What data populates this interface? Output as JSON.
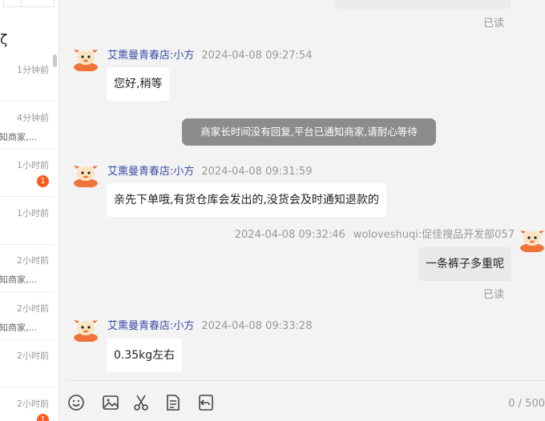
{
  "sidebar": {
    "title_fragment": "ζ",
    "items": [
      {
        "time": "1分钟前",
        "preview": "",
        "badge": ""
      },
      {
        "time": "4分钟前",
        "preview": "知商家,...",
        "badge": ""
      },
      {
        "time": "1小时前",
        "preview": "",
        "badge": "1"
      },
      {
        "time": "1小时前",
        "preview": "",
        "badge": ""
      },
      {
        "time": "2小时前",
        "preview": "知商家,...",
        "badge": ""
      },
      {
        "time": "2小时前",
        "preview": "知商家,...",
        "badge": ""
      },
      {
        "time": "2小时前",
        "preview": "",
        "badge": ""
      },
      {
        "time": "2小时前",
        "preview": "",
        "badge": "1"
      }
    ]
  },
  "chat": {
    "read_status": "已读",
    "messages": [
      {
        "sender": "艾熏曼青春店:小方",
        "time": "2024-04-08 09:27:54",
        "text": "您好,稍等"
      },
      {
        "sender": "艾熏曼青春店:小方",
        "time": "2024-04-08 09:31:59",
        "text": "亲先下单哦,有货仓库会发出的,没货会及时通知退款的"
      },
      {
        "sender": "艾熏曼青春店:小方",
        "time": "2024-04-08 09:33:28",
        "text": "0.35kg左右"
      }
    ],
    "system_notice": "商家长时间没有回复,平台已通知商家,请耐心等待",
    "my_message": {
      "time": "2024-04-08 09:32:46",
      "sender": "woloveshuqi:促佳搜品开发部057",
      "text": "一条裤子多重呢"
    }
  },
  "input": {
    "counter": "0 / 500",
    "tools": [
      "emoji-icon",
      "image-icon",
      "scissors-icon",
      "order-icon",
      "undo-icon"
    ]
  },
  "colors": {
    "accent_name": "#3b4ea8",
    "badge": "#ff5a1f",
    "avatar": "#f0743a",
    "notice_bg": "#8c8c8c"
  }
}
